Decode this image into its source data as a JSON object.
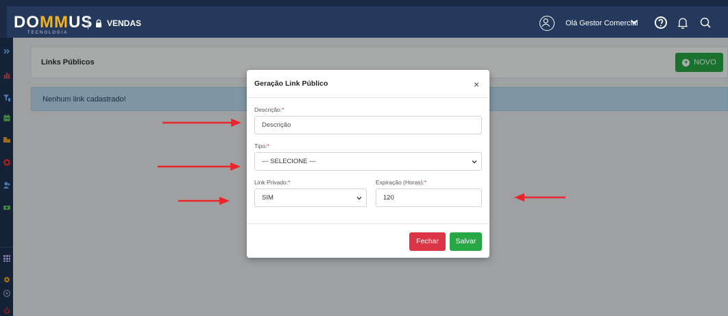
{
  "topbar": {
    "logo_main_prefix": "DO",
    "logo_main_accent": "MM",
    "logo_main_suffix": "US",
    "logo_sub": "TECNOLOGIA",
    "module_label": "VENDAS",
    "user_greeting": "Olá Gestor Comercial",
    "icons": [
      "user-circle-icon",
      "chevron-down-icon",
      "help-icon",
      "bell-icon",
      "search-icon"
    ]
  },
  "sidebar": {
    "icons": [
      "double-chevron-right-icon",
      "chart-icon",
      "filter-icon",
      "calendar-icon",
      "building-icon",
      "circle-icon",
      "user-add-icon",
      "money-icon",
      "grid-icon",
      "gear-icon",
      "support-icon",
      "power-icon"
    ]
  },
  "main": {
    "title": "Links Públicos",
    "new_button_label": "NOVO",
    "alert_text": "Nenhum link cadastrado!"
  },
  "modal": {
    "title": "Geração Link Público",
    "close_label": "×",
    "descricao": {
      "label": "Descrição:",
      "required_mark": "*",
      "placeholder": "Descrição",
      "value": ""
    },
    "tipo": {
      "label": "Tipo:",
      "required_mark": "*",
      "selected": "--- SELECIONE ---"
    },
    "link_privado": {
      "label": "Link Privado:",
      "required_mark": "*",
      "selected": "SIM"
    },
    "expiracao": {
      "label": "Expiração (Horas):",
      "required_mark": "*",
      "value": "120"
    },
    "fechar_label": "Fechar",
    "salvar_label": "Salvar"
  },
  "colors": {
    "topbar": "#24395c",
    "accent_logo": "#f0b323",
    "success": "#28a745",
    "danger": "#dc3545",
    "annotation_arrow": "#e8262b"
  }
}
